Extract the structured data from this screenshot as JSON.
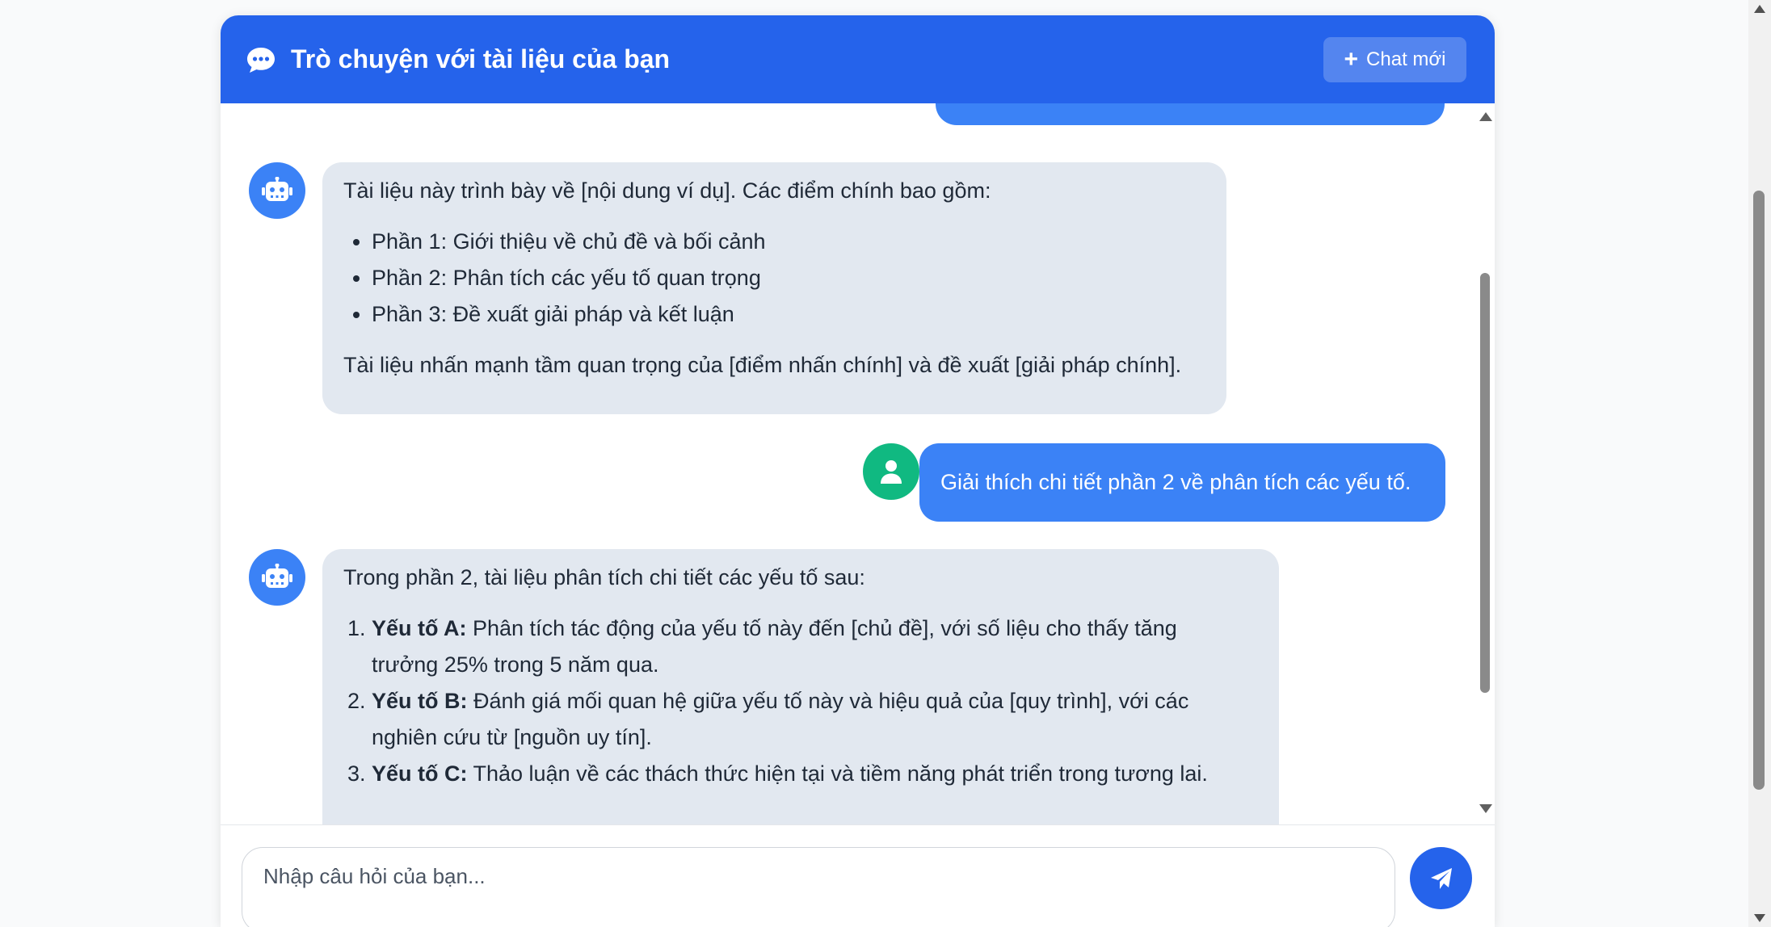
{
  "header": {
    "title": "Trò chuyện với tài liệu của bạn",
    "new_chat_label": "Chat mới",
    "icons": {
      "title": "chat-bubble-icon",
      "new_chat": "plus-icon"
    }
  },
  "messages": {
    "bot1": {
      "intro": "Tài liệu này trình bày về [nội dung ví dụ]. Các điểm chính bao gồm:",
      "items": [
        "Phần 1: Giới thiệu về chủ đề và bối cảnh",
        "Phần 2: Phân tích các yếu tố quan trọng",
        "Phần 3: Đề xuất giải pháp và kết luận"
      ],
      "outro": "Tài liệu nhấn mạnh tầm quan trọng của [điểm nhấn chính] và đề xuất [giải pháp chính]."
    },
    "user1": {
      "text": "Giải thích chi tiết phần 2 về phân tích các yếu tố."
    },
    "bot2": {
      "intro": "Trong phần 2, tài liệu phân tích chi tiết các yếu tố sau:",
      "items": [
        {
          "label": "Yếu tố A:",
          "line1": " Phân tích tác động của yếu tố này đến [chủ đề], với số liệu cho thấy tăng",
          "line2": "trưởng 25% trong 5 năm qua."
        },
        {
          "label": "Yếu tố B:",
          "line1": " Đánh giá mối quan hệ giữa yếu tố này và hiệu quả của [quy trình], với các",
          "line2": "nghiên cứu từ [nguồn uy tín]."
        },
        {
          "label": "Yếu tố C:",
          "line1": " Thảo luận về các thách thức hiện tại và tiềm năng phát triển trong tương lai.",
          "line2": ""
        }
      ]
    },
    "avatar_icons": {
      "bot": "robot-icon",
      "user": "user-icon"
    }
  },
  "input": {
    "placeholder": "Nhập câu hỏi của bạn...",
    "value": "",
    "send_icon": "paper-plane-icon"
  },
  "colors": {
    "header": "#2563eb",
    "user_bubble": "#3b82f6",
    "bot_bubble": "#e2e8f0",
    "bot_avatar": "#3b82f6",
    "user_avatar": "#10b981"
  }
}
